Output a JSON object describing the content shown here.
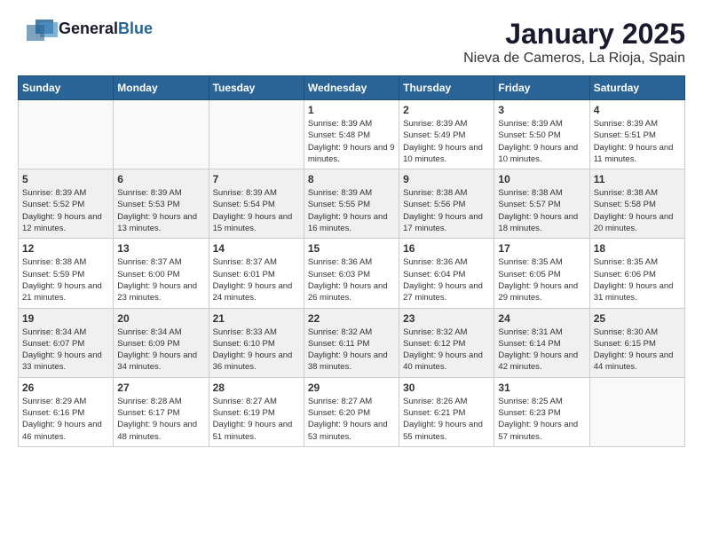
{
  "header": {
    "logo_general": "General",
    "logo_blue": "Blue",
    "title": "January 2025",
    "subtitle": "Nieva de Cameros, La Rioja, Spain"
  },
  "calendar": {
    "days_of_week": [
      "Sunday",
      "Monday",
      "Tuesday",
      "Wednesday",
      "Thursday",
      "Friday",
      "Saturday"
    ],
    "weeks": [
      {
        "shaded": false,
        "days": [
          {
            "num": "",
            "info": ""
          },
          {
            "num": "",
            "info": ""
          },
          {
            "num": "",
            "info": ""
          },
          {
            "num": "1",
            "info": "Sunrise: 8:39 AM\nSunset: 5:48 PM\nDaylight: 9 hours and 9 minutes."
          },
          {
            "num": "2",
            "info": "Sunrise: 8:39 AM\nSunset: 5:49 PM\nDaylight: 9 hours and 10 minutes."
          },
          {
            "num": "3",
            "info": "Sunrise: 8:39 AM\nSunset: 5:50 PM\nDaylight: 9 hours and 10 minutes."
          },
          {
            "num": "4",
            "info": "Sunrise: 8:39 AM\nSunset: 5:51 PM\nDaylight: 9 hours and 11 minutes."
          }
        ]
      },
      {
        "shaded": true,
        "days": [
          {
            "num": "5",
            "info": "Sunrise: 8:39 AM\nSunset: 5:52 PM\nDaylight: 9 hours and 12 minutes."
          },
          {
            "num": "6",
            "info": "Sunrise: 8:39 AM\nSunset: 5:53 PM\nDaylight: 9 hours and 13 minutes."
          },
          {
            "num": "7",
            "info": "Sunrise: 8:39 AM\nSunset: 5:54 PM\nDaylight: 9 hours and 15 minutes."
          },
          {
            "num": "8",
            "info": "Sunrise: 8:39 AM\nSunset: 5:55 PM\nDaylight: 9 hours and 16 minutes."
          },
          {
            "num": "9",
            "info": "Sunrise: 8:38 AM\nSunset: 5:56 PM\nDaylight: 9 hours and 17 minutes."
          },
          {
            "num": "10",
            "info": "Sunrise: 8:38 AM\nSunset: 5:57 PM\nDaylight: 9 hours and 18 minutes."
          },
          {
            "num": "11",
            "info": "Sunrise: 8:38 AM\nSunset: 5:58 PM\nDaylight: 9 hours and 20 minutes."
          }
        ]
      },
      {
        "shaded": false,
        "days": [
          {
            "num": "12",
            "info": "Sunrise: 8:38 AM\nSunset: 5:59 PM\nDaylight: 9 hours and 21 minutes."
          },
          {
            "num": "13",
            "info": "Sunrise: 8:37 AM\nSunset: 6:00 PM\nDaylight: 9 hours and 23 minutes."
          },
          {
            "num": "14",
            "info": "Sunrise: 8:37 AM\nSunset: 6:01 PM\nDaylight: 9 hours and 24 minutes."
          },
          {
            "num": "15",
            "info": "Sunrise: 8:36 AM\nSunset: 6:03 PM\nDaylight: 9 hours and 26 minutes."
          },
          {
            "num": "16",
            "info": "Sunrise: 8:36 AM\nSunset: 6:04 PM\nDaylight: 9 hours and 27 minutes."
          },
          {
            "num": "17",
            "info": "Sunrise: 8:35 AM\nSunset: 6:05 PM\nDaylight: 9 hours and 29 minutes."
          },
          {
            "num": "18",
            "info": "Sunrise: 8:35 AM\nSunset: 6:06 PM\nDaylight: 9 hours and 31 minutes."
          }
        ]
      },
      {
        "shaded": true,
        "days": [
          {
            "num": "19",
            "info": "Sunrise: 8:34 AM\nSunset: 6:07 PM\nDaylight: 9 hours and 33 minutes."
          },
          {
            "num": "20",
            "info": "Sunrise: 8:34 AM\nSunset: 6:09 PM\nDaylight: 9 hours and 34 minutes."
          },
          {
            "num": "21",
            "info": "Sunrise: 8:33 AM\nSunset: 6:10 PM\nDaylight: 9 hours and 36 minutes."
          },
          {
            "num": "22",
            "info": "Sunrise: 8:32 AM\nSunset: 6:11 PM\nDaylight: 9 hours and 38 minutes."
          },
          {
            "num": "23",
            "info": "Sunrise: 8:32 AM\nSunset: 6:12 PM\nDaylight: 9 hours and 40 minutes."
          },
          {
            "num": "24",
            "info": "Sunrise: 8:31 AM\nSunset: 6:14 PM\nDaylight: 9 hours and 42 minutes."
          },
          {
            "num": "25",
            "info": "Sunrise: 8:30 AM\nSunset: 6:15 PM\nDaylight: 9 hours and 44 minutes."
          }
        ]
      },
      {
        "shaded": false,
        "days": [
          {
            "num": "26",
            "info": "Sunrise: 8:29 AM\nSunset: 6:16 PM\nDaylight: 9 hours and 46 minutes."
          },
          {
            "num": "27",
            "info": "Sunrise: 8:28 AM\nSunset: 6:17 PM\nDaylight: 9 hours and 48 minutes."
          },
          {
            "num": "28",
            "info": "Sunrise: 8:27 AM\nSunset: 6:19 PM\nDaylight: 9 hours and 51 minutes."
          },
          {
            "num": "29",
            "info": "Sunrise: 8:27 AM\nSunset: 6:20 PM\nDaylight: 9 hours and 53 minutes."
          },
          {
            "num": "30",
            "info": "Sunrise: 8:26 AM\nSunset: 6:21 PM\nDaylight: 9 hours and 55 minutes."
          },
          {
            "num": "31",
            "info": "Sunrise: 8:25 AM\nSunset: 6:23 PM\nDaylight: 9 hours and 57 minutes."
          },
          {
            "num": "",
            "info": ""
          }
        ]
      }
    ]
  }
}
